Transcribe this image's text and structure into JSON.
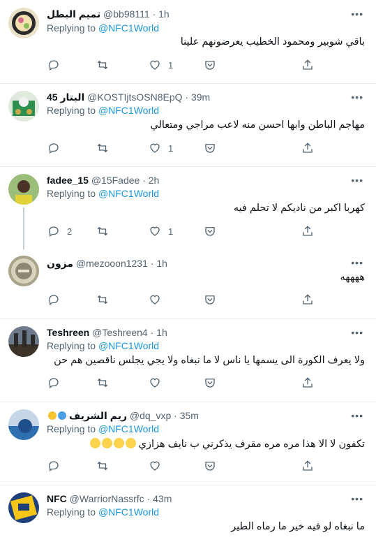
{
  "tweets": [
    {
      "name": "تميم البطل",
      "handle": "@bb98111",
      "time": "1h",
      "replying_to": "@NFC1World",
      "replying_prefix": "Replying to",
      "text": "باقي شوبير ومحمود الخطيب يعرضونهم علينا",
      "reply_count": "",
      "like_count": "1"
    },
    {
      "name": "البتار 45",
      "handle": "@KOSTIjtsOSN8EpQ",
      "time": "39m",
      "replying_to": "@NFC1World",
      "replying_prefix": "Replying to",
      "text": "مهاجم الباطن وابها احسن منه لاعب مراجي ومتعالي",
      "reply_count": "",
      "like_count": "1"
    },
    {
      "name": "fadee_15",
      "handle": "@15Fadee",
      "time": "2h",
      "replying_to": "@NFC1World",
      "replying_prefix": "Replying to",
      "text": "كهربا اكبر من ناديكم لا تحلم فيه",
      "reply_count": "2",
      "like_count": "1"
    },
    {
      "name": "مزون",
      "handle": "@mezooon1231",
      "time": "1h",
      "replying_to": "",
      "replying_prefix": "",
      "text": "ههههه",
      "reply_count": "",
      "like_count": ""
    },
    {
      "name": "Teshreen",
      "handle": "@Teshreen4",
      "time": "1h",
      "replying_to": "@NFC1World",
      "replying_prefix": "Replying to",
      "text": "ولا يعرف الكورة الى يسمها يا ناس لا ما نبغاه ولا يجي يجلس ناقصين هم حن",
      "reply_count": "",
      "like_count": ""
    },
    {
      "name": "ريم الشريف",
      "handle": "@dq_vxp",
      "time": "35m",
      "replying_to": "@NFC1World",
      "replying_prefix": "Replying to",
      "text": "تكفون لا الا هذا مره مره مقرف يذكرني ب نايف هزازي",
      "reply_count": "",
      "like_count": ""
    },
    {
      "name": "NFC",
      "handle": "@WarriorNassrfc",
      "time": "43m",
      "replying_to": "@NFC1World",
      "replying_prefix": "Replying to",
      "text": "ما نبغاه لو فيه خير ما رماه الطير",
      "reply_count": "",
      "like_count": ""
    }
  ],
  "separator": "·",
  "more_glyph": "•••",
  "colors": {
    "link": "#1b95e0",
    "muted": "#536471",
    "separator": "#e6ecf0"
  }
}
